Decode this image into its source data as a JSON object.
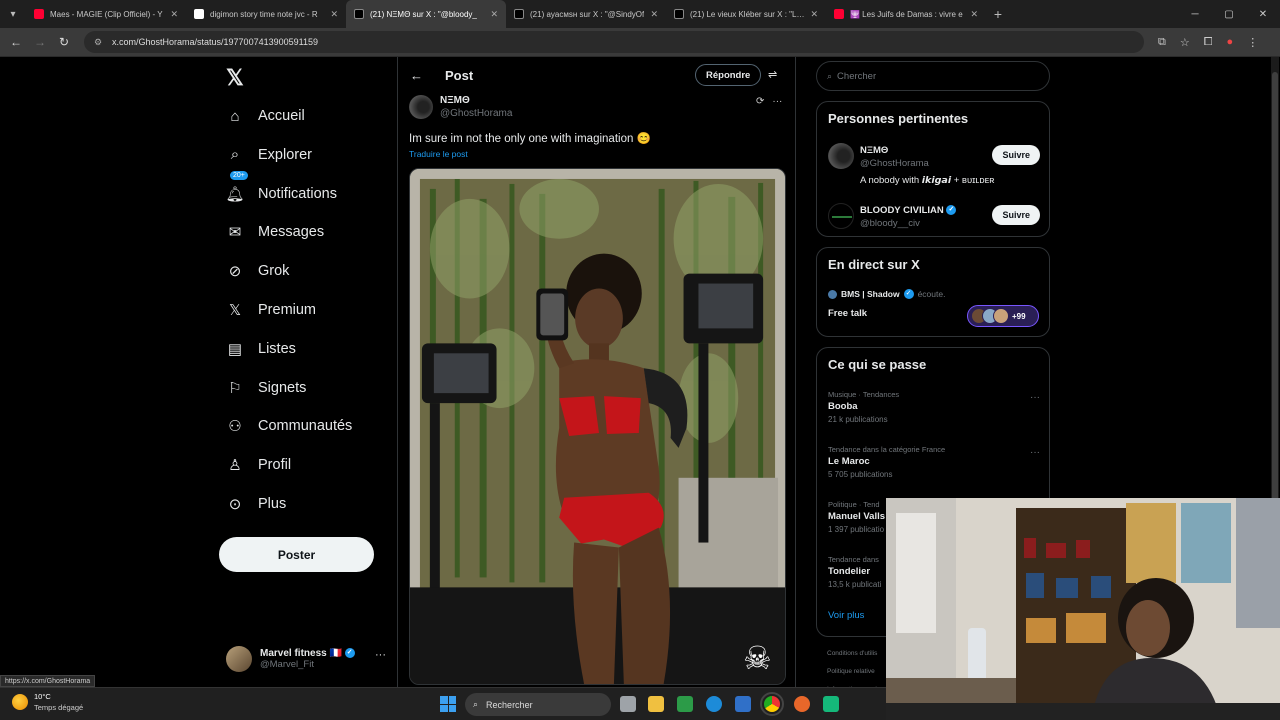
{
  "browser": {
    "tabs": [
      {
        "title": "Maes - MAGIE (Clip Officiel) - Y",
        "color": "#ff0033",
        "active": false
      },
      {
        "title": "digimon story time note jvc - R",
        "color": "#ffffff",
        "active": false
      },
      {
        "title": "(21) NΞMΘ sur X : \"@bloody_",
        "color": "#000000",
        "active": true
      },
      {
        "title": "(21) ayacмsн sur X : \"@SindyOf",
        "color": "#000000",
        "active": false
      },
      {
        "title": "(21) Le vieux Kléber sur X : \"Les",
        "color": "#000000",
        "active": false
      },
      {
        "title": "🕎 Les Juifs de Damas : vivre e",
        "color": "#ff0033",
        "active": false
      }
    ],
    "url": "x.com/GhostHorama/status/1977007413900591159",
    "status_url": "https://x.com/GhostHorama"
  },
  "nav": {
    "logo": "𝕏",
    "items": [
      {
        "label": "Accueil",
        "icon": "home-icon",
        "glyph": "⌂"
      },
      {
        "label": "Explorer",
        "icon": "search-icon",
        "glyph": "⌕"
      },
      {
        "label": "Notifications",
        "icon": "bell-icon",
        "glyph": "🔔︎"
      },
      {
        "label": "Messages",
        "icon": "mail-icon",
        "glyph": "✉"
      },
      {
        "label": "Grok",
        "icon": "grok-icon",
        "glyph": "⊘"
      },
      {
        "label": "Premium",
        "icon": "x-premium-icon",
        "glyph": "𝕏"
      },
      {
        "label": "Listes",
        "icon": "list-icon",
        "glyph": "▤"
      },
      {
        "label": "Signets",
        "icon": "bookmark-icon",
        "glyph": "⚐"
      },
      {
        "label": "Communautés",
        "icon": "communities-icon",
        "glyph": "⚇"
      },
      {
        "label": "Profil",
        "icon": "profile-icon",
        "glyph": "♙"
      },
      {
        "label": "Plus",
        "icon": "more-circle-icon",
        "glyph": "⊙"
      }
    ],
    "notif_badge": "20+",
    "post_button": "Poster",
    "account": {
      "name": "Marvel fitness",
      "flag": "🇫🇷",
      "handle": "@Marvel_Fit",
      "more": "···"
    }
  },
  "main": {
    "back": "←",
    "title": "Post",
    "reply_button": "Répondre",
    "author_name": "NΞMΘ",
    "author_handle": "@GhostHorama",
    "text": "Im sure im not the only one with imagination 😊",
    "translate": "Traduire le post",
    "watermark": "☠"
  },
  "right": {
    "search_placeholder": "Chercher",
    "relevant": {
      "title": "Personnes pertinentes",
      "people": [
        {
          "name": "NΞMΘ",
          "handle": "@GhostHorama",
          "bio": "A nobody with 𝙞𝙠𝙞𝙜𝙖𝙞 + ʙᴜɪʟᴅᴇʀ",
          "follow": "Suivre"
        },
        {
          "name": "BLOODY CIVILIAN",
          "handle": "@bloody__civ",
          "bio": "",
          "follow": "Suivre"
        }
      ]
    },
    "live": {
      "title": "En direct sur X",
      "host": "BMS | Shadow",
      "host_status": "écoute.",
      "space_title": "Free talk",
      "count": "+99"
    },
    "trends": {
      "title": "Ce qui se passe",
      "items": [
        {
          "category": "Musique · Tendances",
          "name": "Booba",
          "count": "21 k publications"
        },
        {
          "category": "Tendance dans la catégorie France",
          "name": "Le Maroc",
          "count": "5 705 publications"
        },
        {
          "category": "Politique · Tend",
          "name": "Manuel Valls",
          "count": "1 397 publicatio"
        },
        {
          "category": "Tendance dans",
          "name": "Tondelier",
          "count": "13,5 k publicati"
        }
      ],
      "see_more": "Voir plus"
    },
    "footer": [
      "Conditions d'utilis",
      "Politique relative",
      "Informations sur l"
    ]
  },
  "taskbar": {
    "temperature": "10°C",
    "weather": "Temps dégagé",
    "search": "Rechercher"
  }
}
